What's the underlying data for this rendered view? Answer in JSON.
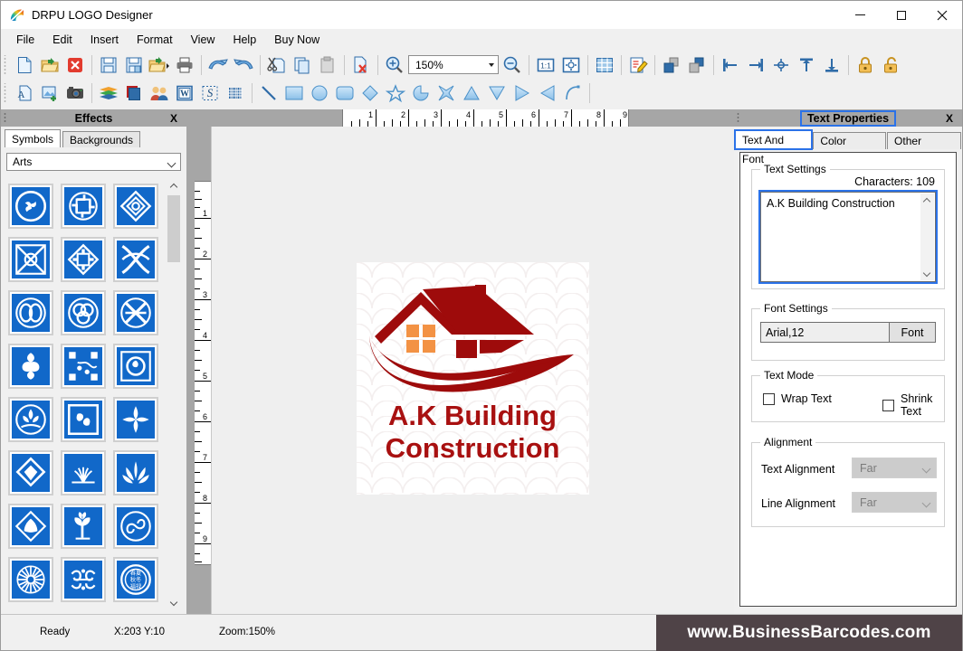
{
  "window": {
    "title": "DRPU LOGO Designer",
    "icon": "app-logo-icon",
    "minimize": "—",
    "maximize": "□",
    "close": "✕"
  },
  "menubar": {
    "items": [
      "File",
      "Edit",
      "Insert",
      "Format",
      "View",
      "Help",
      "Buy Now"
    ]
  },
  "toolbar1": {
    "zoom_value": "150%",
    "icons": [
      "new-document-icon",
      "open-folder-icon",
      "close-document-icon",
      "save-icon",
      "save-as-icon",
      "import-icon",
      "print-icon",
      "undo-icon",
      "redo-icon",
      "cut-icon",
      "copy-icon",
      "paste-icon",
      "delete-icon",
      "zoom-in-icon",
      "zoom-out-icon",
      "actual-size-icon",
      "fit-page-icon",
      "grid-icon",
      "edit-properties-icon",
      "bring-to-front-icon",
      "send-to-back-icon",
      "align-left-icon",
      "align-right-icon",
      "align-center-icon",
      "align-top-icon",
      "align-bottom-icon",
      "lock-icon",
      "unlock-icon"
    ]
  },
  "toolbar2": {
    "icons": [
      "insert-text-icon",
      "insert-image-icon",
      "capture-image-icon",
      "layers-icon",
      "background-icon",
      "contact-icon",
      "word-art-icon",
      "signature-icon",
      "barcode-icon",
      "line-tool-icon",
      "rectangle-tool-icon",
      "ellipse-tool-icon",
      "rounded-rect-tool-icon",
      "diamond-tool-icon",
      "star-tool-icon",
      "pie-tool-icon",
      "four-point-star-tool-icon",
      "triangle-up-tool-icon",
      "triangle-down-tool-icon",
      "triangle-right-tool-icon",
      "triangle-left-tool-icon",
      "arc-tool-icon"
    ]
  },
  "left_panel": {
    "title": "Effects",
    "close_label": "X",
    "tabs": [
      {
        "label": "Symbols",
        "active": true
      },
      {
        "label": "Backgrounds",
        "active": false
      }
    ],
    "category_selected": "Arts",
    "category_icon": "chevron-down-icon",
    "scroll_up_icon": "scroll-up-icon",
    "scroll_down_icon": "scroll-down-icon",
    "symbols": [
      "triple-swirl-symbol",
      "circular-knot-symbol",
      "diamond-spiral-symbol",
      "square-cross-weave-symbol",
      "diamond-cross-symbol",
      "interlace-x-symbol",
      "double-loop-symbol",
      "trefoil-knot-symbol",
      "woven-x-symbol",
      "four-petal-symbol",
      "dot-network-symbol",
      "comma-circle-symbol",
      "lotus-crest-symbol",
      "paired-comma-symbol",
      "butterfly-leaf-symbol",
      "diamond-drop-symbol",
      "fan-shell-symbol",
      "palm-leaf-symbol",
      "shell-diamond-symbol",
      "oak-tree-symbol",
      "spiral-wave-symbol",
      "snowflake-circle-symbol",
      "scroll-vine-symbol",
      "coin-circle-symbol",
      "heart-floral-symbol",
      "mountain-bird-symbol",
      "twin-wave-symbol"
    ]
  },
  "rulers": {
    "horizontal_ticks": [
      "1",
      "2",
      "3",
      "4",
      "5",
      "6",
      "7",
      "8",
      "9"
    ],
    "vertical_ticks": [
      "1",
      "2",
      "3",
      "4",
      "5",
      "6",
      "7",
      "8",
      "9"
    ]
  },
  "canvas": {
    "logo": {
      "line1": "A.K Building",
      "line2": "Construction",
      "text_color": "#a81010",
      "roof_color": "#9e0b0b",
      "window_color": "#f39244",
      "background": "#ffffff",
      "pattern_color": "#f2eeee"
    }
  },
  "right_panel": {
    "title": "Text Properties",
    "close_label": "X",
    "tabs": [
      {
        "label": "Text And Font",
        "active": true
      },
      {
        "label": "Color Effects",
        "active": false
      },
      {
        "label": "Other Effects",
        "active": false
      }
    ],
    "text_settings": {
      "group_label": "Text Settings",
      "char_count_label": "Characters: 109",
      "value": "A.K Building Construction"
    },
    "font_settings": {
      "group_label": "Font Settings",
      "font_value": "Arial,12",
      "font_button": "Font"
    },
    "text_mode": {
      "group_label": "Text Mode",
      "wrap_text": "Wrap Text",
      "wrap_checked": false,
      "shrink_text": "Shrink Text",
      "shrink_checked": false
    },
    "alignment": {
      "group_label": "Alignment",
      "text_alignment_label": "Text Alignment",
      "text_alignment_value": "Far",
      "line_alignment_label": "Line Alignment",
      "line_alignment_value": "Far"
    },
    "accent_color": "#2b72e8"
  },
  "statusbar": {
    "ready": "Ready",
    "coords": "X:203  Y:10",
    "zoom": "Zoom:150%",
    "brand": "www.BusinessBarcodes.com"
  }
}
